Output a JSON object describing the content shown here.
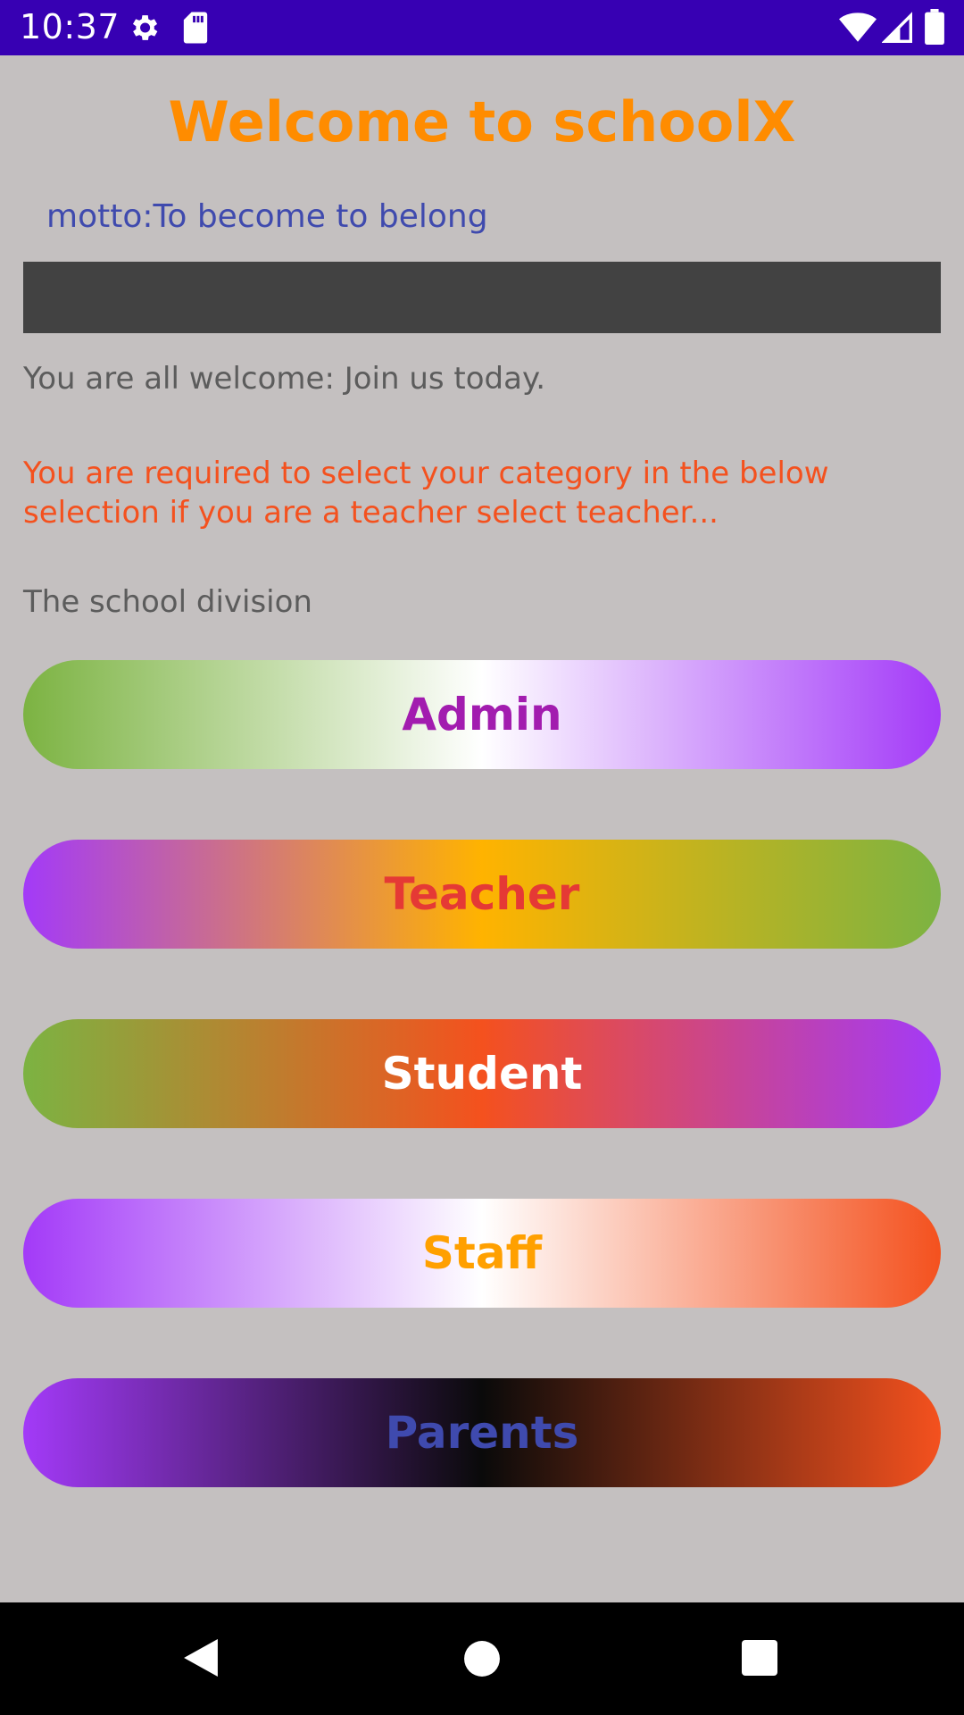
{
  "status_bar": {
    "time": "10:37",
    "icons": [
      "gear-icon",
      "sd-card-icon",
      "wifi-icon",
      "signal-icon",
      "battery-icon"
    ],
    "background": "#3700b3"
  },
  "header": {
    "title": "Welcome to schoolX",
    "motto": "motto:To become to belong"
  },
  "body": {
    "welcome_text": "You are all welcome: Join us today.",
    "instruction_text": "You are required to select your category in the below selection if you are a teacher select teacher...",
    "division_label": "The school division"
  },
  "categories": [
    {
      "label": "Admin",
      "text_color": "#a21caf",
      "gradient": [
        "#7cb342",
        "#ffffff",
        "#a33af8"
      ]
    },
    {
      "label": "Teacher",
      "text_color": "#e53935",
      "gradient": [
        "#a33af8",
        "#ffb300",
        "#7cb342"
      ]
    },
    {
      "label": "Student",
      "text_color": "#ffffff",
      "gradient": [
        "#7cb342",
        "#f4511e",
        "#a33af8"
      ]
    },
    {
      "label": "Staff",
      "text_color": "#ffa000",
      "gradient": [
        "#a33af8",
        "#ffffff",
        "#f4511e"
      ]
    },
    {
      "label": "Parents",
      "text_color": "#3f4aae",
      "gradient": [
        "#a33af8",
        "#0a0a0a",
        "#f4511e"
      ]
    }
  ],
  "colors": {
    "title": "#ff8c00",
    "motto": "#3f4aae",
    "instruction": "#f4511e",
    "page_background": "#c4c0c0"
  },
  "nav_bar": {
    "icons": [
      "back-icon",
      "home-icon",
      "recent-apps-icon"
    ]
  }
}
